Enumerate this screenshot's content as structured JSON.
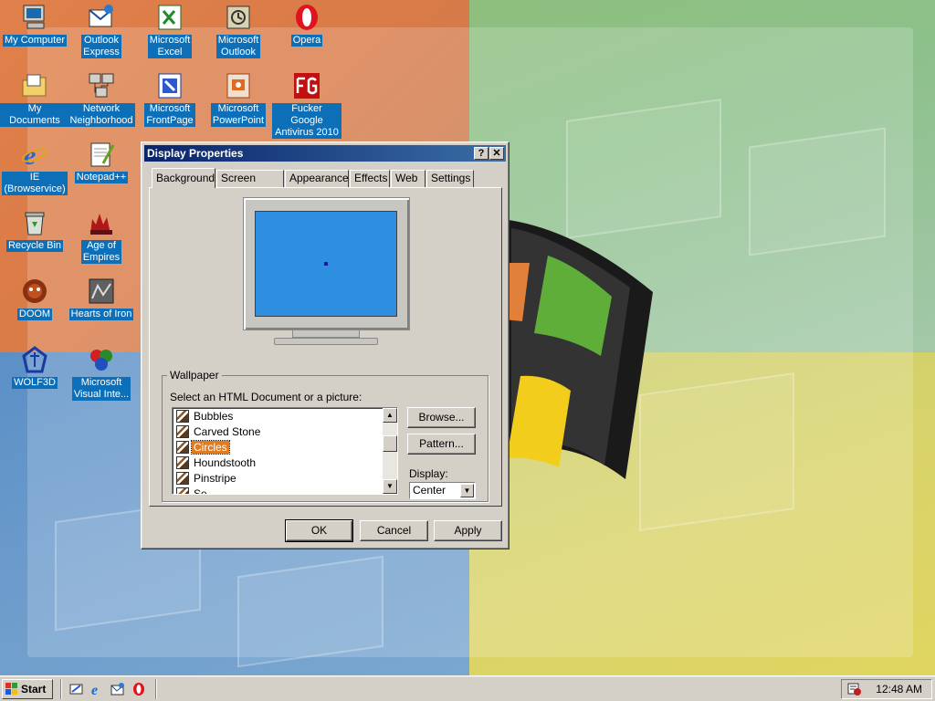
{
  "desktop": {
    "icons": [
      {
        "id": "my-computer",
        "label": "My Computer"
      },
      {
        "id": "outlook-express",
        "label": "Outlook\nExpress"
      },
      {
        "id": "microsoft-excel",
        "label": "Microsoft\nExcel"
      },
      {
        "id": "microsoft-outlook",
        "label": "Microsoft\nOutlook"
      },
      {
        "id": "opera",
        "label": "Opera"
      },
      {
        "id": "my-documents",
        "label": "My Documents"
      },
      {
        "id": "network-neighborhood",
        "label": "Network\nNeighborhood"
      },
      {
        "id": "microsoft-frontpage",
        "label": "Microsoft\nFrontPage"
      },
      {
        "id": "microsoft-powerpoint",
        "label": "Microsoft\nPowerPoint"
      },
      {
        "id": "fucker-google-antivirus",
        "label": "Fucker Google\nAntivirus 2010"
      },
      {
        "id": "ie-browservice",
        "label": "IE\n(Browservice)"
      },
      {
        "id": "notepad-plus-plus",
        "label": "Notepad++"
      },
      {
        "id": "recycle-bin",
        "label": "Recycle Bin"
      },
      {
        "id": "age-of-empires",
        "label": "Age of\nEmpires"
      },
      {
        "id": "doom",
        "label": "DOOM"
      },
      {
        "id": "hearts-of-iron",
        "label": "Hearts of Iron"
      },
      {
        "id": "wolf3d",
        "label": "WOLF3D"
      },
      {
        "id": "microsoft-visual-inte",
        "label": "Microsoft\nVisual Inte..."
      }
    ]
  },
  "window": {
    "title": "Display Properties",
    "help_button": "?",
    "close_button": "✕",
    "tabs": [
      "Background",
      "Screen Saver",
      "Appearance",
      "Effects",
      "Web",
      "Settings"
    ],
    "active_tab": "Background",
    "wallpaper": {
      "group_label": "Wallpaper",
      "caption": "Select an HTML Document or a picture:",
      "items": [
        "Bubbles",
        "Carved Stone",
        "Circles",
        "Houndstooth",
        "Pinstripe",
        "Se..."
      ],
      "selected": "Circles"
    },
    "browse_button": "Browse...",
    "pattern_button": "Pattern...",
    "display_label": "Display:",
    "display_value": "Center",
    "ok_button": "OK",
    "cancel_button": "Cancel",
    "apply_button": "Apply",
    "preview_color": "#2e8fe0"
  },
  "taskbar": {
    "start_label": "Start",
    "clock": "12:48 AM"
  },
  "colors": {
    "title_gradient_start": "#0a246a",
    "title_gradient_end": "#3a6ea5",
    "selection": "#e07b20",
    "icon_label_bg": "#0d6fb8"
  }
}
